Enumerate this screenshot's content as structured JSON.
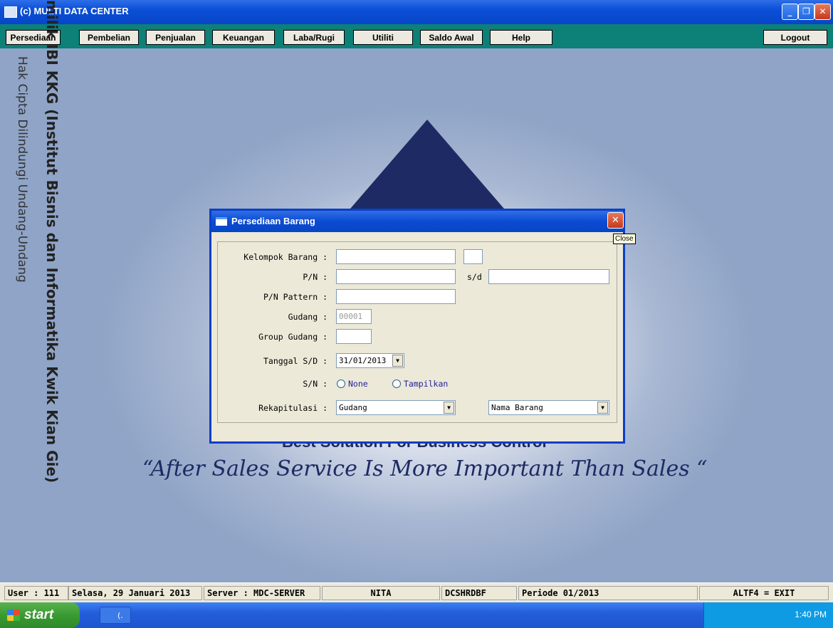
{
  "window": {
    "title": "(c) MULTI DATA CENTER"
  },
  "menu": {
    "items": [
      "Persediaan",
      "Pembelian",
      "Penjualan",
      "Keuangan",
      "Laba/Rugi",
      "Utiliti",
      "Saldo Awal",
      "Help"
    ],
    "logout": "Logout"
  },
  "background": {
    "company_line": "Best Solution For Business Control",
    "tagline": "“After Sales Service Is More Important Than Sales “"
  },
  "watermark": {
    "line1": "Hak Cipta Dilindungi Undang-Undang",
    "line2": "milik IBI KKG (Institut Bisnis dan Informatika Kwik Kian Gie)"
  },
  "dialog": {
    "title": "Persediaan Barang",
    "close_tooltip": "Close",
    "fields": {
      "kelompok_label": "Kelompok Barang :",
      "pn_label": "P/N :",
      "sd_label": "s/d",
      "pattern_label": "P/N Pattern :",
      "gudang_label": "Gudang :",
      "gudang_value": "00001",
      "group_gudang_label": "Group Gudang :",
      "tanggal_label": "Tanggal S/D :",
      "tanggal_value": "31/01/2013",
      "sn_label": "S/N :",
      "sn_options": [
        "None",
        "Tampilkan"
      ],
      "rekap_label": "Rekapitulasi :",
      "rekap_value": "Gudang",
      "sort_value": "Nama Barang"
    }
  },
  "status": {
    "user": "User : 111",
    "date": "Selasa, 29 Januari 2013",
    "server": "Server : MDC-SERVER",
    "name": "NITA",
    "db": "DCSHRDBF",
    "periode": "Periode 01/2013",
    "exit": "ALTF4 = EXIT"
  },
  "taskbar": {
    "start": "start",
    "task": "(.",
    "clock": "1:40 PM"
  },
  "colors": {
    "menubar": "#0d8078",
    "brand": "#1d2a63",
    "titlebar": "#0a4fd6"
  }
}
